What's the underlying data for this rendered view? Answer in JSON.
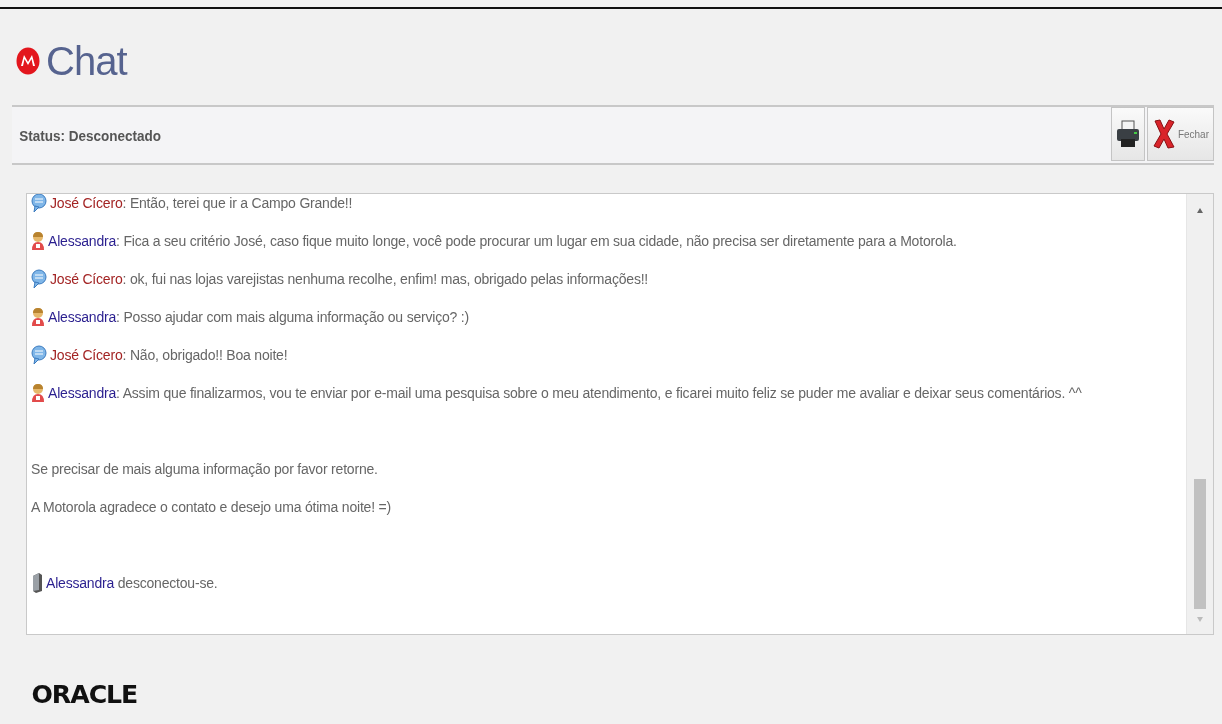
{
  "header": {
    "title": "Chat"
  },
  "status_bar": {
    "status": "Status: Desconectado",
    "buttons": [
      {
        "kind": "print"
      },
      {
        "kind": "close",
        "label": "Fechar"
      }
    ]
  },
  "messages": [
    {
      "kind": "customer",
      "sender": "José Cícero",
      "text": ": Então, terei que ir a Campo Grande!!"
    },
    {
      "kind": "agent",
      "sender": "Alessandra",
      "text": ": Fica a seu critério José, caso fique muito longe, você pode procurar um lugar em sua cidade, não precisa ser diretamente para a Motorola."
    },
    {
      "kind": "customer",
      "sender": "José Cícero",
      "text": ": ok, fui nas lojas varejistas nenhuma recolhe, enfim! mas, obrigado pelas informações!!"
    },
    {
      "kind": "agent",
      "sender": "Alessandra",
      "text": ": Posso ajudar com mais alguma informação ou serviço? :)"
    },
    {
      "kind": "customer",
      "sender": "José Cícero",
      "text": ": Não, obrigado!! Boa noite!"
    },
    {
      "kind": "agent",
      "sender": "Alessandra",
      "text": ": Assim que finalizarmos, vou te enviar por e-mail uma pesquisa sobre o meu atendimento, e ficarei muito feliz se puder me avaliar e deixar seus comentários. ^^"
    },
    {
      "kind": "note",
      "text": "Se precisar de mais alguma informação por favor retorne."
    },
    {
      "kind": "note",
      "text": "A Motorola agradece o contato e desejo uma ótima noite! =)"
    },
    {
      "kind": "event",
      "sender": "Alessandra",
      "text": "desconectou-se."
    }
  ],
  "footer": {
    "logo": "ORACLE"
  }
}
